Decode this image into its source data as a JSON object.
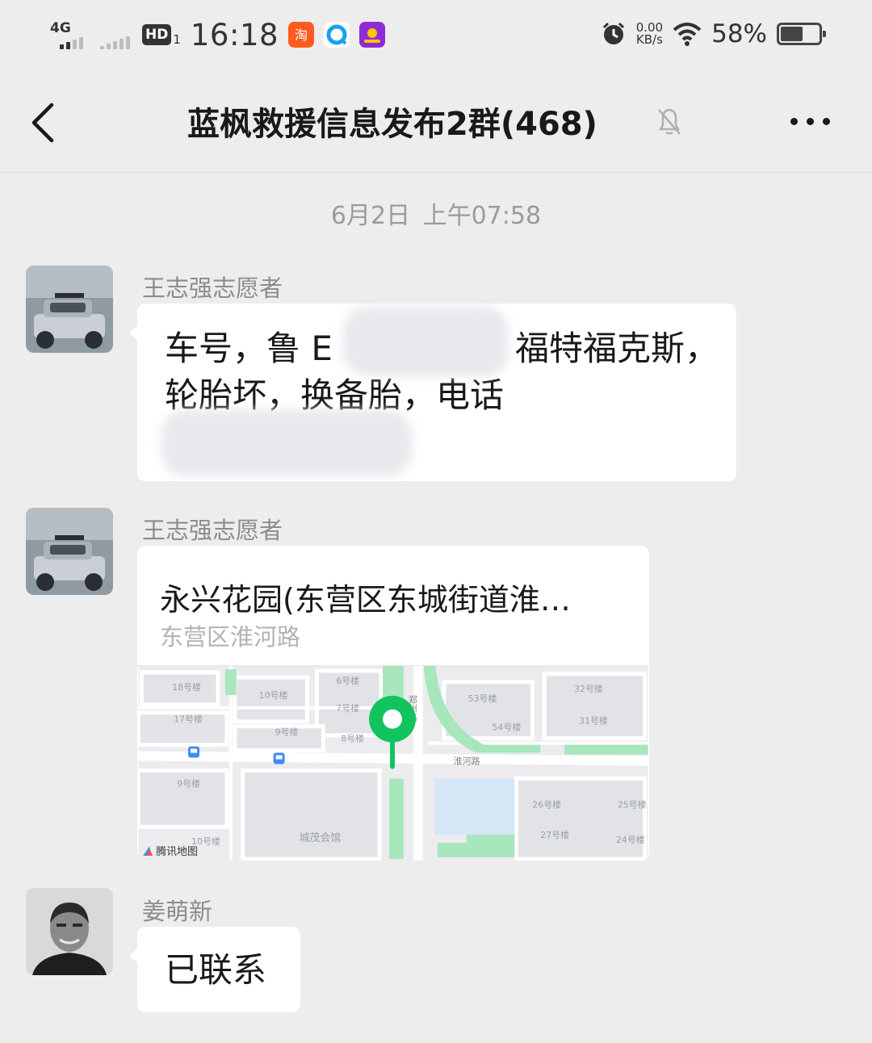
{
  "status_bar": {
    "network": "4G",
    "hd": "HD",
    "sim": "1",
    "time": "16:18",
    "speed_value": "0.00",
    "speed_unit": "KB/s",
    "battery": "58%",
    "battery_level": 0.58
  },
  "header": {
    "title": "蓝枫救援信息发布2群(468)"
  },
  "timestamp": "6月2日  上午07:58",
  "messages": [
    {
      "sender": "王志强志愿者",
      "line1_a": "车号，鲁 E",
      "line1_b": "福特福克斯，",
      "line2": "轮胎坏，换备胎，电话"
    },
    {
      "sender": "王志强志愿者",
      "location_title": "永兴花园(东营区东城街道淮…",
      "location_sub": "东营区淮河路",
      "map_labels": {
        "b18": "18号楼",
        "b10": "10号楼",
        "b6": "6号楼",
        "b7": "7号楼",
        "b17": "17号楼",
        "b9": "9号楼",
        "b8": "8号楼",
        "b9b": "9号楼",
        "b53": "53号楼",
        "b54": "54号楼",
        "b32": "32号楼",
        "b31": "31号楼",
        "b26": "26号楼",
        "b27": "27号楼",
        "b25": "25号楼",
        "b24": "24号楼",
        "b10b": "10号楼",
        "zhengzhou": "郑州路",
        "huaihe": "淮河路",
        "hall": "城茂会馆",
        "brand": "腾讯地图"
      },
      "colors": {
        "pin": "#11c45d",
        "green_area": "#a8e6bd",
        "map_bg": "#ececee"
      }
    },
    {
      "sender": "姜萌新",
      "text": "已联系"
    }
  ]
}
